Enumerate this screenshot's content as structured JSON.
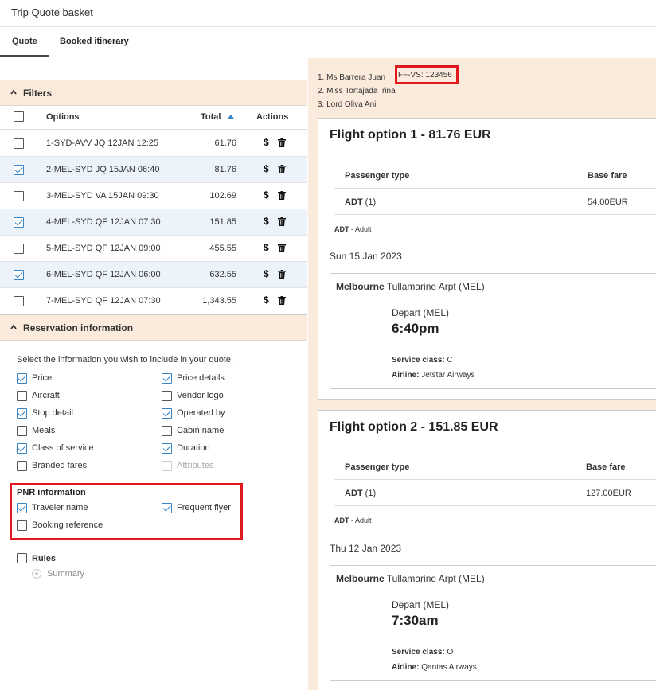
{
  "app": {
    "title": "Trip Quote basket"
  },
  "tabs": [
    {
      "label": "Quote",
      "active": true
    },
    {
      "label": "Booked itinerary",
      "active": false
    }
  ],
  "filters": {
    "title": "Filters",
    "columns": {
      "options": "Options",
      "total": "Total",
      "actions": "Actions"
    },
    "rows": [
      {
        "name": "1-SYD-AVV JQ 12JAN 12:25",
        "total": "61.76",
        "checked": false
      },
      {
        "name": "2-MEL-SYD JQ 15JAN 06:40",
        "total": "81.76",
        "checked": true
      },
      {
        "name": "3-MEL-SYD VA 15JAN 09:30",
        "total": "102.69",
        "checked": false
      },
      {
        "name": "4-MEL-SYD QF 12JAN 07:30",
        "total": "151.85",
        "checked": true
      },
      {
        "name": "5-MEL-SYD QF 12JAN 09:00",
        "total": "455.55",
        "checked": false
      },
      {
        "name": "6-MEL-SYD QF 12JAN 06:00",
        "total": "632.55",
        "checked": true
      },
      {
        "name": "7-MEL-SYD QF 12JAN 07:30",
        "total": "1,343.55",
        "checked": false
      }
    ],
    "dollar_symbol": "$"
  },
  "reservation": {
    "title": "Reservation information",
    "intro": "Select the information you wish to include in your quote.",
    "options_left": [
      {
        "label": "Price",
        "checked": true
      },
      {
        "label": "Aircraft",
        "checked": false
      },
      {
        "label": "Stop detail",
        "checked": true
      },
      {
        "label": "Meals",
        "checked": false
      },
      {
        "label": "Class of service",
        "checked": true
      },
      {
        "label": "Branded fares",
        "checked": false
      }
    ],
    "options_right": [
      {
        "label": "Price details",
        "checked": true
      },
      {
        "label": "Vendor logo",
        "checked": false
      },
      {
        "label": "Operated by",
        "checked": true
      },
      {
        "label": "Cabin name",
        "checked": false
      },
      {
        "label": "Duration",
        "checked": true
      },
      {
        "label": "Attributes",
        "checked": false,
        "disabled": true
      }
    ],
    "pnr": {
      "title": "PNR information",
      "traveler_name": "Traveler name",
      "frequent_flyer": "Frequent flyer",
      "booking_reference": "Booking reference"
    },
    "rules": {
      "label": "Rules",
      "summary": "Summary"
    }
  },
  "travelers": {
    "line1": "1. Ms Barrera Juan",
    "ff": "FF-VS: 123456",
    "line2": "2. Miss Tortajada Irina",
    "line3": "3. Lord Oliva Anil"
  },
  "flight_options": [
    {
      "title": "Flight option 1 - 81.76 EUR",
      "th_passenger": "Passenger type",
      "th_fare": "Base fare",
      "ptype": "ADT",
      "pcount": "(1)",
      "fare": "54.00EUR",
      "note_code": "ADT",
      "note_text": " - Adult",
      "date": "Sun 15 Jan 2023",
      "city": "Melbourne",
      "airport": "Tullamarine Arpt (MEL)",
      "depart_label": "Depart (MEL)",
      "depart_time": "6:40pm",
      "service_label": "Service class:",
      "service_value": "C",
      "airline_label": "Airline:",
      "airline_value": "Jetstar Airways"
    },
    {
      "title": "Flight option 2 - 151.85 EUR",
      "th_passenger": "Passenger type",
      "th_fare": "Base fare",
      "ptype": "ADT",
      "pcount": "(1)",
      "fare": "127.00EUR",
      "note_code": "ADT",
      "note_text": " - Adult",
      "date": "Thu 12 Jan 2023",
      "city": "Melbourne",
      "airport": "Tullamarine Arpt (MEL)",
      "depart_label": "Depart (MEL)",
      "depart_time": "7:30am",
      "service_label": "Service class:",
      "service_value": "O",
      "airline_label": "Airline:",
      "airline_value": "Qantas Airways"
    }
  ],
  "colors": {
    "section_bg": "#fbebdd",
    "highlight_red": "#e0191f",
    "check_blue": "#2f7ec2",
    "selected_row": "#edf3fa"
  }
}
